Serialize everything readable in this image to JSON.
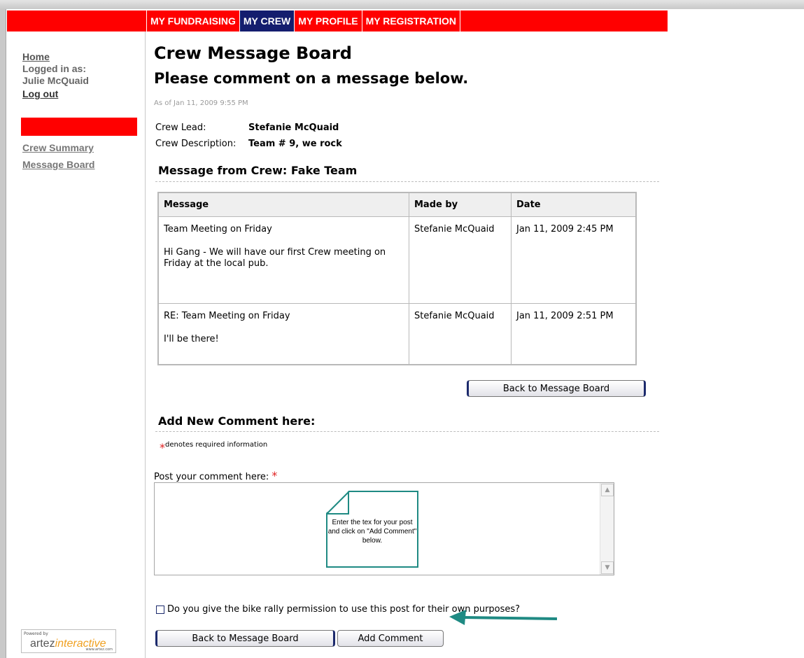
{
  "nav": {
    "tabs": [
      {
        "label": "MY FUNDRAISING",
        "active": false
      },
      {
        "label": "MY CREW",
        "active": true
      },
      {
        "label": "MY PROFILE",
        "active": false
      },
      {
        "label": "MY REGISTRATION",
        "active": false
      }
    ]
  },
  "sidebar": {
    "home_label": "Home",
    "logged_in_label": "Logged in as:",
    "user_name": "Julie McQuaid",
    "logout_label": "Log out",
    "links": [
      "Crew Summary",
      "Message Board"
    ],
    "logo": {
      "powered_by": "Powered by",
      "brand_a": "artez",
      "brand_b": "interactive",
      "url": "www.artez.com"
    }
  },
  "main": {
    "title": "Crew Message Board",
    "subtitle": "Please comment on a message below.",
    "as_of": "As of Jan 11, 2009 9:55 PM",
    "crew_lead_label": "Crew Lead:",
    "crew_lead": "Stefanie McQuaid",
    "crew_description_label": "Crew Description:",
    "crew_description": "Team # 9, we rock",
    "messages_heading": "Message from Crew: Fake Team",
    "table": {
      "columns": [
        "Message",
        "Made by",
        "Date"
      ],
      "rows": [
        {
          "subject": "Team Meeting on Friday",
          "body": "Hi Gang - We will have our first Crew meeting on Friday at the local pub.",
          "made_by": "Stefanie McQuaid",
          "date": "Jan 11, 2009 2:45 PM"
        },
        {
          "subject": "RE: Team Meeting on Friday",
          "body": "I'll be there!",
          "made_by": "Stefanie McQuaid",
          "date": "Jan 11, 2009 2:51 PM"
        }
      ]
    },
    "back_button_label": "Back to Message Board",
    "add_heading": "Add New Comment here:",
    "required_star": "*",
    "required_note": "denotes required information",
    "post_label": "Post your comment here:",
    "comment_value": "",
    "callout_text": "Enter the tex for your post and click on \"Add Comment\" below.",
    "permission_text": "Do you give the bike rally permission to use this post for their own purposes?",
    "permission_checked": false,
    "back_button_label_2": "Back to Message Board",
    "add_comment_label": "Add Comment"
  },
  "colors": {
    "nav_red": "#ff0000",
    "nav_active": "#141d6e",
    "callout_teal": "#1f8a83"
  }
}
